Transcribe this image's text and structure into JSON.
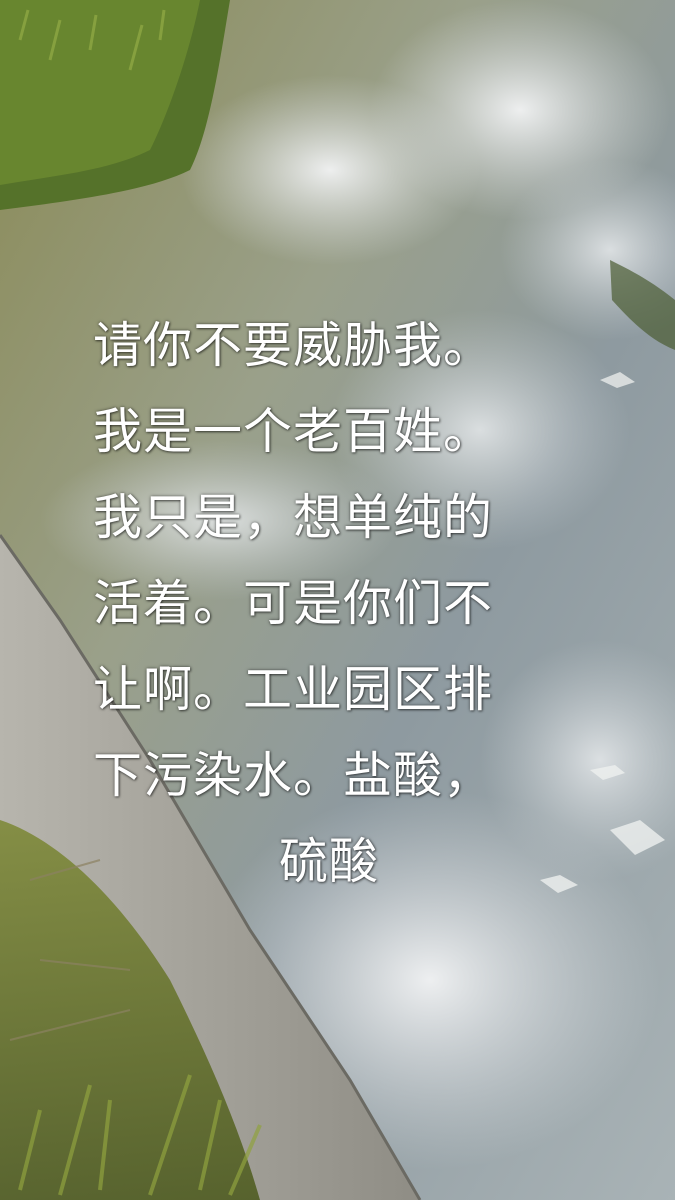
{
  "caption": {
    "lines": [
      "请你不要威胁我。",
      "我是一个老百姓。",
      "我只是，想单纯的",
      "活着。可是你们不",
      "让啊。工业园区排",
      "下污染水。盐酸，",
      "硫酸"
    ]
  }
}
